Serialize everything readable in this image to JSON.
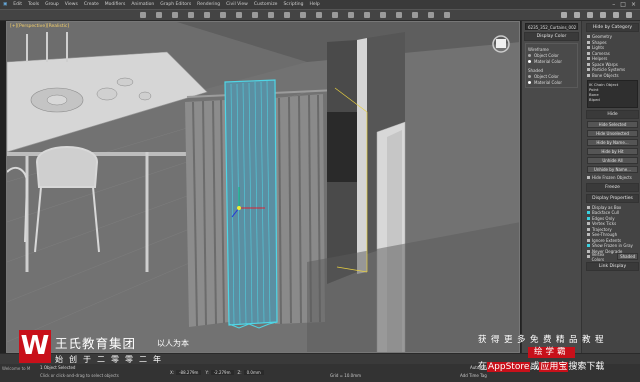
{
  "menu": {
    "items": [
      "Edit",
      "Tools",
      "Group",
      "Views",
      "Create",
      "Modifiers",
      "Animation",
      "Graph Editors",
      "Rendering",
      "Civil View",
      "Customize",
      "Scripting",
      "Help"
    ]
  },
  "viewport": {
    "label": "[+][Perspective][Realistic]"
  },
  "panel": {
    "object_name": "6235_352_Curtains_002",
    "display_color_title": "Display Color",
    "wireframe_label": "Wireframe",
    "shaded_label": "Shaded",
    "object_color": "Object Color",
    "material_color": "Material Color",
    "hide_by_category_title": "Hide by Category",
    "categories": [
      "Geometry",
      "Shapes",
      "Lights",
      "Cameras",
      "Helpers",
      "Space Warps",
      "Particle Systems",
      "Bone Objects"
    ],
    "category_buttons": [
      "All",
      "None",
      "Invert"
    ],
    "list_items": [
      "IK Chain Object",
      "Point",
      "Bone",
      "Biped"
    ],
    "add_btn": "Add...",
    "remove_btn": "Remove",
    "none_btn": "None",
    "hide_title": "Hide",
    "hide_buttons": [
      "Hide Selected",
      "Hide Unselected",
      "Hide by Name...",
      "Hide by Hit",
      "Unhide All",
      "Unhide by Name...",
      "Hide Frozen Objects"
    ],
    "freeze_title": "Freeze",
    "display_props_title": "Display Properties",
    "display_props": [
      "Display as Box",
      "Backface Cull",
      "Edges Only",
      "Vertex Ticks",
      "Trajectory",
      "See-Through",
      "Ignore Extents",
      "Show Frozen in Gray",
      "Never Degrade",
      "Vertex Colors"
    ],
    "shaded_btn": "Shaded",
    "link_display_title": "Link Display"
  },
  "status": {
    "selection": "1 Object Selected",
    "prompt": "Click or click-and-drag to select objects",
    "x_label": "X:",
    "x_value": "-88.279m",
    "y_label": "Y:",
    "y_value": "-2.279m",
    "z_label": "Z:",
    "z_value": "0.0mm",
    "grid": "Grid = 10.0mm",
    "auto_key": "Auto Key",
    "selected_label": "Selected",
    "set_key": "Set Key",
    "key_filters": "Key Filters...",
    "add_time_tag": "Add Time Tag",
    "maxscript": "Welcome to M"
  },
  "watermark": {
    "logo_char": "W",
    "company": "王氏教育集团",
    "motto": "以人为本",
    "since": "始创于二零零二年",
    "right_line1": "获得更多免费精品教程",
    "right_line2": "绘学霸",
    "right_line3_a": "在",
    "right_line3_b": "AppStore",
    "right_line3_c": "或",
    "right_line3_d": "应用宝",
    "right_line3_e": "搜索下载"
  },
  "colors": {
    "viewport_bg": "#6a6a6a",
    "selection_cyan": "#4fd6e6",
    "brand_red": "#c8101a"
  }
}
